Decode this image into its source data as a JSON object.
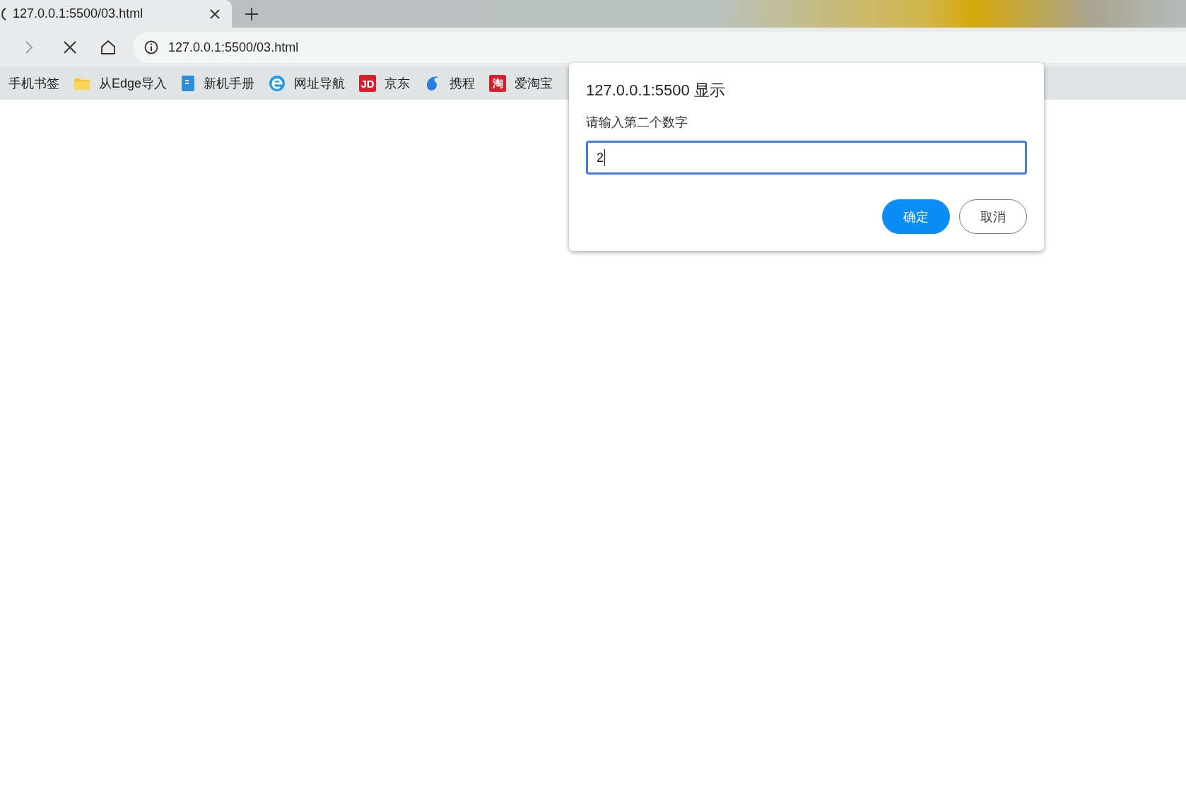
{
  "tab": {
    "title": "127.0.0.1:5500/03.html",
    "loading": true
  },
  "toolbar": {
    "forward_disabled": true,
    "address": "127.0.0.1:5500/03.html"
  },
  "bookmarks": [
    {
      "label": "手机书签",
      "kind": "plain"
    },
    {
      "label": "从Edge导入",
      "kind": "folder"
    },
    {
      "label": "新机手册",
      "kind": "doc"
    },
    {
      "label": "网址导航",
      "kind": "globe"
    },
    {
      "label": "京东",
      "kind": "badge",
      "badge": "JD"
    },
    {
      "label": "携程",
      "kind": "dolphin"
    },
    {
      "label": "爱淘宝",
      "kind": "badge",
      "badge": "淘"
    }
  ],
  "dialog": {
    "title": "127.0.0.1:5500 显示",
    "message": "请输入第二个数字",
    "input": {
      "value": "2",
      "focused": true
    },
    "buttons": [
      {
        "label": "确定",
        "kind": "primary"
      },
      {
        "label": "取消",
        "kind": "secondary"
      }
    ]
  }
}
